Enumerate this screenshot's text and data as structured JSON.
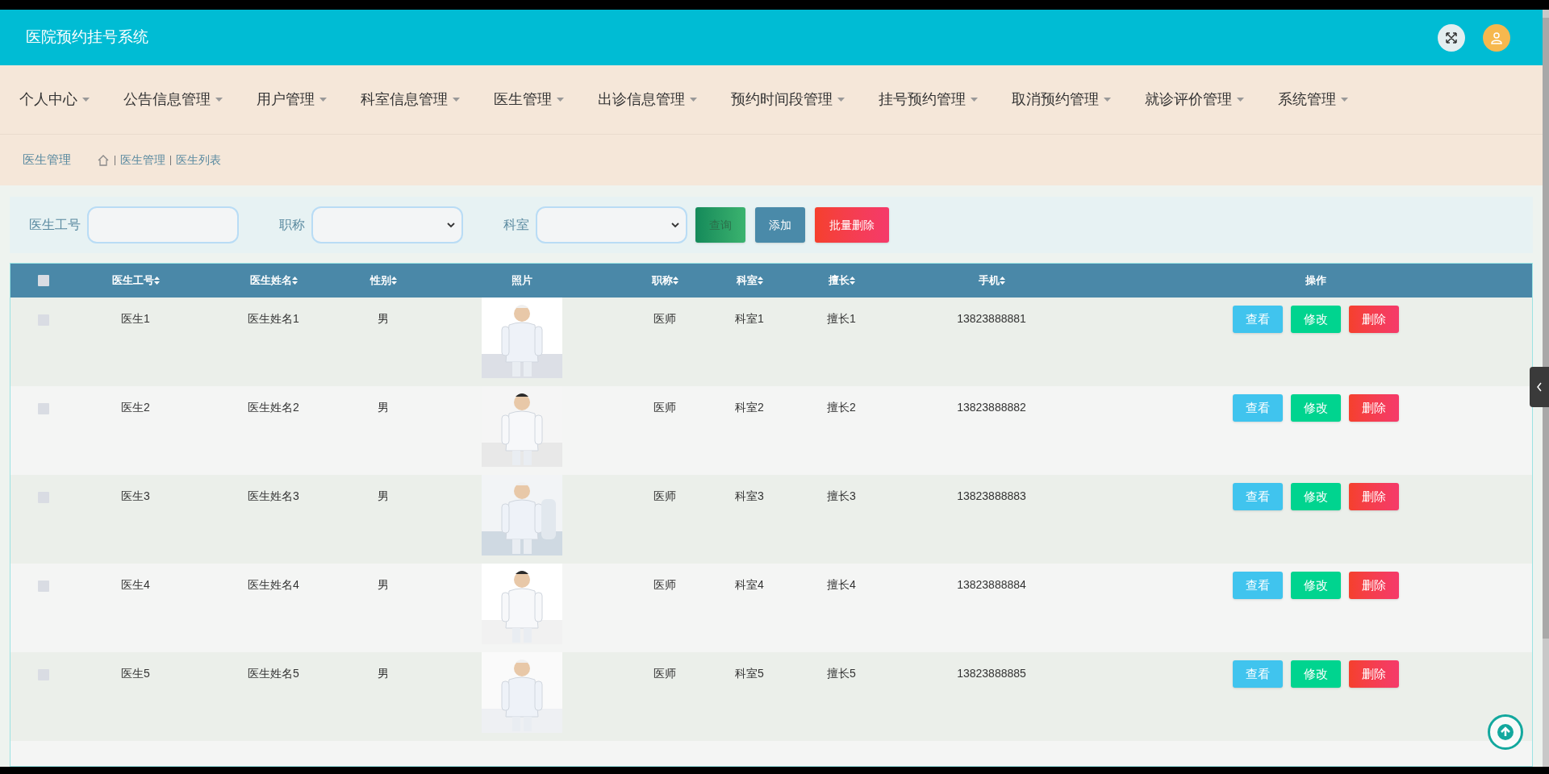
{
  "header": {
    "title": "医院预约挂号系统"
  },
  "nav": [
    {
      "label": "个人中心"
    },
    {
      "label": "公告信息管理"
    },
    {
      "label": "用户管理"
    },
    {
      "label": "科室信息管理"
    },
    {
      "label": "医生管理"
    },
    {
      "label": "出诊信息管理"
    },
    {
      "label": "预约时间段管理"
    },
    {
      "label": "挂号预约管理"
    },
    {
      "label": "取消预约管理"
    },
    {
      "label": "就诊评价管理"
    },
    {
      "label": "系统管理"
    }
  ],
  "breadcrumb": {
    "title": "医生管理",
    "path": [
      "医生管理",
      "医生列表"
    ]
  },
  "search": {
    "fields": [
      {
        "label": "医生工号",
        "kind": "input"
      },
      {
        "label": "职称",
        "kind": "select"
      },
      {
        "label": "科室",
        "kind": "select"
      }
    ],
    "buttons": [
      {
        "label": "查询",
        "kind": "search"
      },
      {
        "label": "添加",
        "kind": "add"
      },
      {
        "label": "批量删除",
        "kind": "delete"
      }
    ]
  },
  "table": {
    "select_all_checked": false,
    "columns": [
      {
        "label": "医生工号",
        "sortable": true
      },
      {
        "label": "医生姓名",
        "sortable": true
      },
      {
        "label": "性别",
        "sortable": true
      },
      {
        "label": "照片",
        "sortable": false
      },
      {
        "label": "职称",
        "sortable": true
      },
      {
        "label": "科室",
        "sortable": true
      },
      {
        "label": "擅长",
        "sortable": true
      },
      {
        "label": "手机",
        "sortable": true
      },
      {
        "label": "操作",
        "sortable": false
      }
    ],
    "rows": [
      {
        "checked": false,
        "doctor_id": "医生1",
        "doctor_name": "医生姓名1",
        "gender": "男",
        "title": "医师",
        "department": "科室1",
        "specialty": "擅长1",
        "phone": "13823888881",
        "actions": [
          {
            "label": "查看",
            "kind": "view"
          },
          {
            "label": "修改",
            "kind": "edit"
          },
          {
            "label": "删除",
            "kind": "delete"
          }
        ]
      },
      {
        "checked": false,
        "doctor_id": "医生2",
        "doctor_name": "医生姓名2",
        "gender": "男",
        "title": "医师",
        "department": "科室2",
        "specialty": "擅长2",
        "phone": "13823888882",
        "actions": [
          {
            "label": "查看",
            "kind": "view"
          },
          {
            "label": "修改",
            "kind": "edit"
          },
          {
            "label": "删除",
            "kind": "delete"
          }
        ]
      },
      {
        "checked": false,
        "doctor_id": "医生3",
        "doctor_name": "医生姓名3",
        "gender": "男",
        "title": "医师",
        "department": "科室3",
        "specialty": "擅长3",
        "phone": "13823888883",
        "actions": [
          {
            "label": "查看",
            "kind": "view"
          },
          {
            "label": "修改",
            "kind": "edit"
          },
          {
            "label": "删除",
            "kind": "delete"
          }
        ]
      },
      {
        "checked": false,
        "doctor_id": "医生4",
        "doctor_name": "医生姓名4",
        "gender": "男",
        "title": "医师",
        "department": "科室4",
        "specialty": "擅长4",
        "phone": "13823888884",
        "actions": [
          {
            "label": "查看",
            "kind": "view"
          },
          {
            "label": "修改",
            "kind": "edit"
          },
          {
            "label": "删除",
            "kind": "delete"
          }
        ]
      },
      {
        "checked": false,
        "doctor_id": "医生5",
        "doctor_name": "医生姓名5",
        "gender": "男",
        "title": "医师",
        "department": "科室5",
        "specialty": "擅长5",
        "phone": "13823888885",
        "actions": [
          {
            "label": "查看",
            "kind": "view"
          },
          {
            "label": "修改",
            "kind": "edit"
          },
          {
            "label": "删除",
            "kind": "delete"
          }
        ]
      }
    ]
  }
}
